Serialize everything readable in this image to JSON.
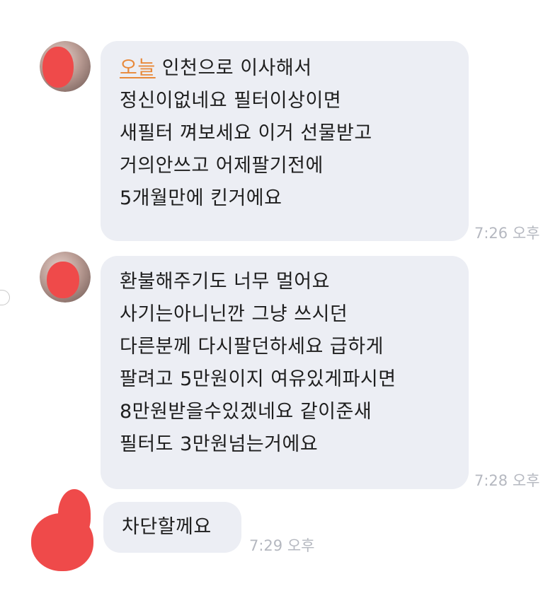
{
  "messages": [
    {
      "lines": [
        {
          "highlight": "오늘",
          "rest": " 인천으로 이사해서"
        },
        {
          "text": "정신이없네요  필터이상이면"
        },
        {
          "text": "새필터 껴보세요 이거 선물받고"
        },
        {
          "text": "거의안쓰고 어제팔기전에"
        },
        {
          "text": "5개월만에 킨거에요"
        }
      ],
      "time": "7:26 오후"
    },
    {
      "lines": [
        {
          "text": "환불해주기도 너무 멀어요"
        },
        {
          "text": "사기는아니닌깐  그냥 쓰시던"
        },
        {
          "text": "다른분께 다시팔던하세요  급하게"
        },
        {
          "text": "팔려고 5만원이지 여유있게파시면"
        },
        {
          "text": "8만원받을수있겠네요 같이준새"
        },
        {
          "text": "필터도 3만원넘는거에요"
        }
      ],
      "time": "7:28 오후"
    },
    {
      "lines": [
        {
          "text": "차단할께요"
        }
      ],
      "time": "7:29 오후"
    }
  ],
  "colors": {
    "bubble": "#eceef4",
    "text": "#1e1e1e",
    "highlight": "#e8893a",
    "time": "#b5b8c0",
    "redaction": "#ef4a4a"
  }
}
